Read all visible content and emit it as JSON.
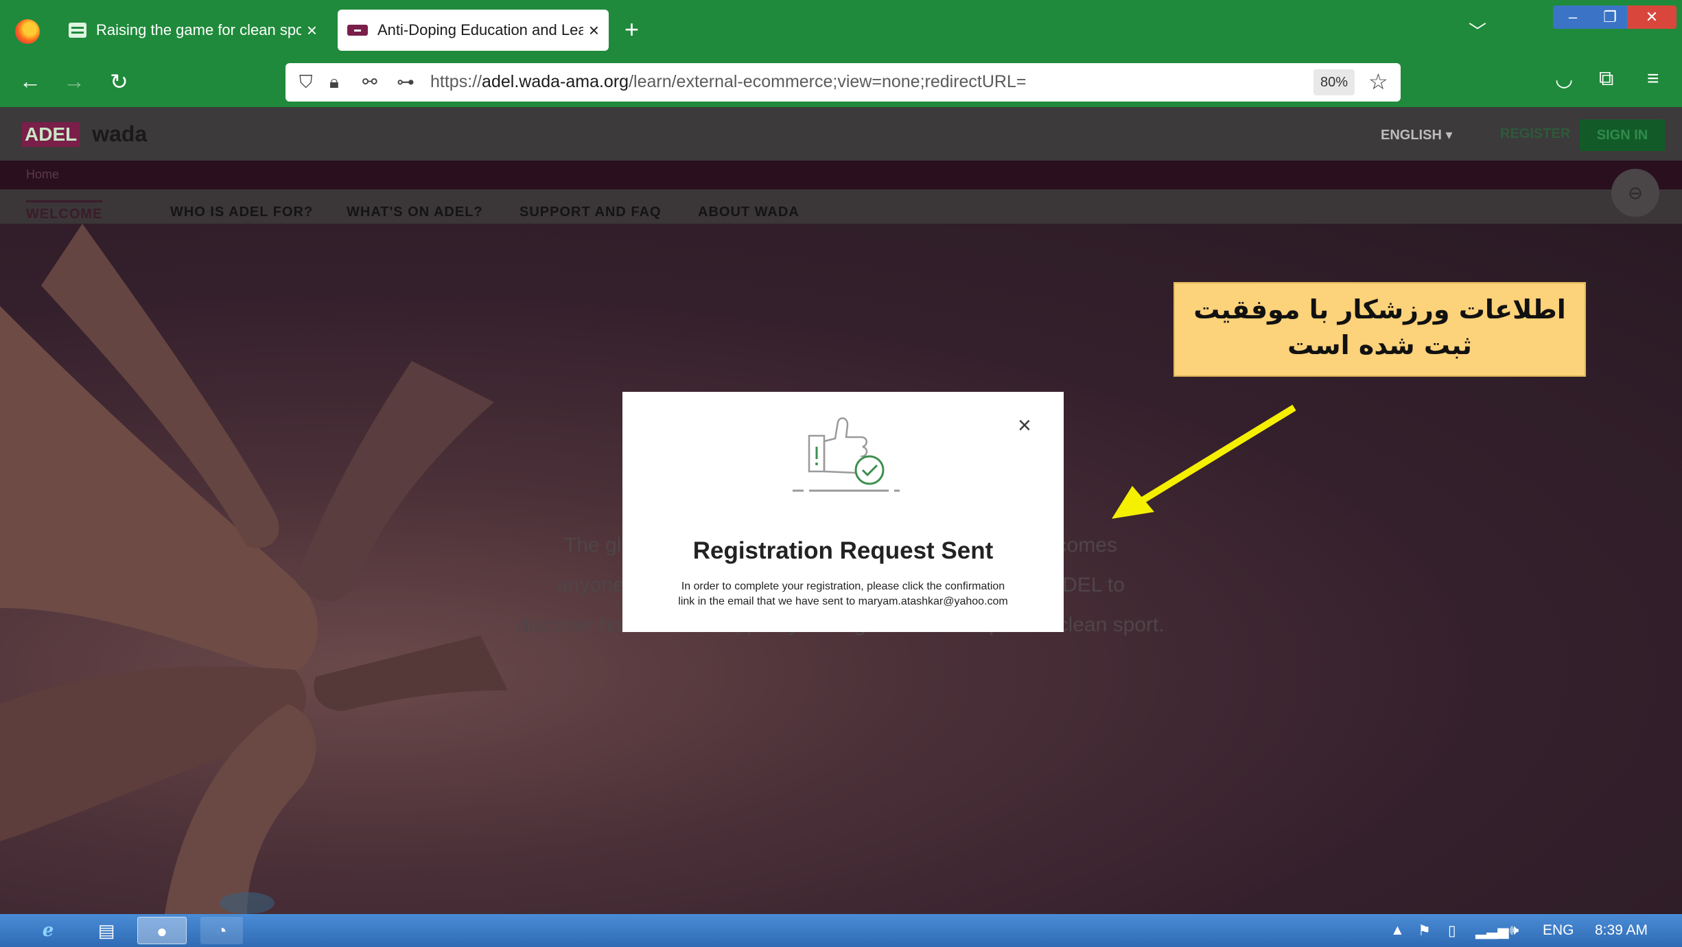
{
  "browser": {
    "tabs": [
      {
        "title": "Raising the game for clean spor",
        "active": false
      },
      {
        "title": "Anti-Doping Education and Lea",
        "active": true
      }
    ],
    "new_tab": "+",
    "close_glyph": "×",
    "url_prefix": "https://",
    "url_domain": "adel.wada-ama.org",
    "url_path": "/learn/external-ecommerce;view=none;redirectURL=",
    "zoom": "80%",
    "icons": [
      "firefox-logo",
      "back-arrow-icon",
      "forward-arrow-icon",
      "reload-icon",
      "shield-icon",
      "lock-icon",
      "permissions-icon",
      "key-icon",
      "star-icon",
      "pocket-icon",
      "extensions-icon",
      "menu-icon"
    ],
    "window_controls": {
      "minimize": "–",
      "maximize": "❐",
      "close": "✕"
    }
  },
  "site": {
    "logo_adel": "ADEL",
    "logo_wada": "wada",
    "language": "ENGLISH",
    "register": "REGISTER",
    "signin": "SIGN IN",
    "breadcrumb": "Home",
    "nav": [
      "WELCOME",
      "WHO IS ADEL FOR?",
      "WHAT'S ON ADEL?",
      "SUPPORT AND FAQ",
      "ABOUT WADA"
    ],
    "hero_text_lines": [
      "The global A                                                          L welcomes",
      "anyone wh                                                                 in ADEL to",
      "discover how we can support you. Together we can protect clean sport."
    ]
  },
  "modal": {
    "title": "Registration Request Sent",
    "body_line1": "In order to complete your registration, please click the confirmation",
    "body_line2": "link in the email that we have sent to maryam.atashkar@yahoo.com",
    "close": "×"
  },
  "annotation": {
    "line1": "اطلاعات ورزشکار با موفقیت",
    "line2": "ثبت شده است",
    "bg_color": "#fcd27a",
    "arrow_color": "#f5f000"
  },
  "taskbar": {
    "language": "ENG",
    "time": "8:39 AM"
  }
}
